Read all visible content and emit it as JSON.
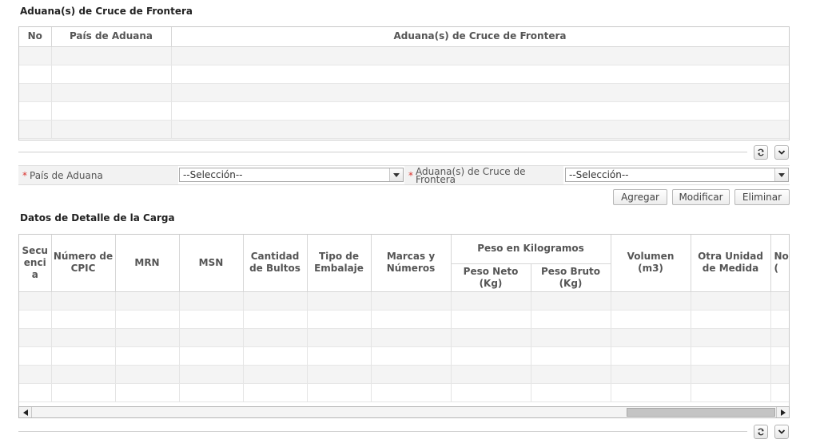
{
  "section1": {
    "title": "Aduana(s) de Cruce de Frontera",
    "columns": [
      "No",
      "País de Aduana",
      "Aduana(s) de Cruce de Frontera"
    ]
  },
  "form": {
    "pais_label": "País de Aduana",
    "pais_value": "--Selección--",
    "aduana_label_1": "Aduana(s) de Cruce de",
    "aduana_label_2": "Frontera",
    "aduana_value": "--Selección--",
    "required_mark": "*"
  },
  "buttons": {
    "add": "Agregar",
    "modify": "Modificar",
    "delete": "Eliminar"
  },
  "section2": {
    "title": "Datos de Detalle de la Carga",
    "col_secuencia": [
      "Secu",
      "enci",
      "a"
    ],
    "col_cpic": [
      "Número de",
      "CPIC"
    ],
    "col_mrn": "MRN",
    "col_msn": "MSN",
    "col_bultos": [
      "Cantidad",
      "de Bultos"
    ],
    "col_embalaje": [
      "Tipo de",
      "Embalaje"
    ],
    "col_marcas": [
      "Marcas y",
      "Números"
    ],
    "col_peso_group": "Peso en Kilogramos",
    "col_peso_neto": [
      "Peso Neto",
      "(Kg)"
    ],
    "col_peso_bruto": [
      "Peso Bruto",
      "(Kg)"
    ],
    "col_volumen": [
      "Volumen",
      "(m3)"
    ],
    "col_otra": [
      "Otra Unidad",
      "de Medida"
    ],
    "col_partial": [
      "No",
      "("
    ]
  },
  "icons": {
    "refresh": "refresh-icon",
    "collapse": "chevron-down-icon"
  }
}
